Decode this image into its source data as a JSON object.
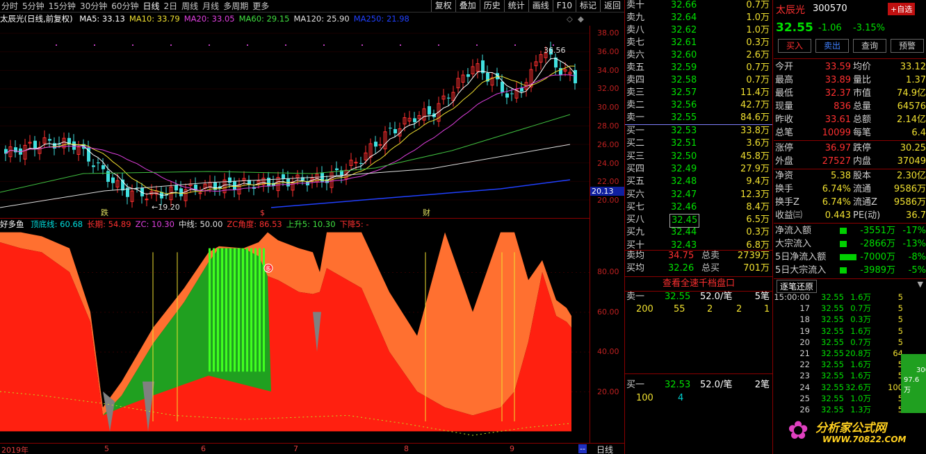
{
  "toolbar": {
    "periods": [
      "分时",
      "5分钟",
      "15分钟",
      "30分钟",
      "60分钟",
      "日线",
      "2日",
      "周线",
      "月线",
      "多周期",
      "更多"
    ],
    "active": "日线",
    "right_buttons": [
      "复权",
      "叠加",
      "历史",
      "统计",
      "画线",
      "F10",
      "标记",
      "返回"
    ]
  },
  "chart": {
    "title": "太辰光(日线,前复权)",
    "ma": [
      {
        "label": "MA5: 33.13",
        "color": "#ffffff"
      },
      {
        "label": "MA10: 33.79",
        "color": "#f0e030"
      },
      {
        "label": "MA20: 33.05",
        "color": "#e040e0"
      },
      {
        "label": "MA60: 29.15",
        "color": "#40e040"
      },
      {
        "label": "MA120: 25.90",
        "color": "#e0e0e0"
      },
      {
        "label": "MA250: 21.98",
        "color": "#2040ff"
      }
    ],
    "y_ticks": [
      "38.00",
      "36.00",
      "34.00",
      "32.00",
      "30.00",
      "28.00",
      "26.00",
      "24.00",
      "22.00",
      "20.00"
    ],
    "current_price_tag": "20.13",
    "high_label": "36.56",
    "low_label": "←19.20",
    "markers": [
      "跌",
      "$",
      "财"
    ]
  },
  "indicator": {
    "name": "好多鱼",
    "params": [
      {
        "label": "顶底线: 60.68",
        "color": "#00e0e0"
      },
      {
        "label": "长期: 54.89",
        "color": "#ff3030"
      },
      {
        "label": "ZC: 10.30",
        "color": "#e040e0"
      },
      {
        "label": "中线: 50.00",
        "color": "#e0e0e0"
      },
      {
        "label": "ZC角度: 86.53",
        "color": "#ff3030"
      },
      {
        "label": "上升5: 10.30",
        "color": "#40e040"
      },
      {
        "label": "下降5: -",
        "color": "#ff3030"
      }
    ],
    "y_ticks": [
      "80.00",
      "60.00",
      "40.00",
      "20.00"
    ],
    "marker": "多"
  },
  "date_axis": {
    "labels": [
      "2019年",
      "5",
      "6",
      "7",
      "8",
      "9"
    ],
    "corner": "--",
    "period_label": "日线"
  },
  "orderbook": {
    "asks": [
      {
        "label": "卖十",
        "price": "32.66",
        "vol": "0.7万"
      },
      {
        "label": "卖九",
        "price": "32.64",
        "vol": "1.0万"
      },
      {
        "label": "卖八",
        "price": "32.62",
        "vol": "1.0万"
      },
      {
        "label": "卖七",
        "price": "32.61",
        "vol": "0.3万"
      },
      {
        "label": "卖六",
        "price": "32.60",
        "vol": "2.6万"
      },
      {
        "label": "卖五",
        "price": "32.59",
        "vol": "0.7万"
      },
      {
        "label": "卖四",
        "price": "32.58",
        "vol": "0.7万"
      },
      {
        "label": "卖三",
        "price": "32.57",
        "vol": "11.4万"
      },
      {
        "label": "卖二",
        "price": "32.56",
        "vol": "42.7万"
      },
      {
        "label": "卖一",
        "price": "32.55",
        "vol": "84.6万"
      }
    ],
    "bids": [
      {
        "label": "买一",
        "price": "32.53",
        "vol": "33.8万"
      },
      {
        "label": "买二",
        "price": "32.51",
        "vol": "3.6万"
      },
      {
        "label": "买三",
        "price": "32.50",
        "vol": "45.8万"
      },
      {
        "label": "买四",
        "price": "32.49",
        "vol": "27.9万"
      },
      {
        "label": "买五",
        "price": "32.48",
        "vol": "9.4万"
      },
      {
        "label": "买六",
        "price": "32.47",
        "vol": "12.3万"
      },
      {
        "label": "买七",
        "price": "32.46",
        "vol": "8.4万"
      },
      {
        "label": "买八",
        "price": "32.45",
        "vol": "6.5万"
      },
      {
        "label": "买九",
        "price": "32.44",
        "vol": "0.3万"
      },
      {
        "label": "买十",
        "price": "32.43",
        "vol": "6.8万"
      }
    ],
    "avg_sell": {
      "label": "卖均",
      "price": "34.75",
      "total_label": "总卖",
      "total": "2739万"
    },
    "avg_buy": {
      "label": "买均",
      "price": "32.26",
      "total_label": "总买",
      "total": "701万"
    },
    "depth_link": "查看全速千档盘口",
    "sell1_detail": {
      "label": "卖一",
      "price": "32.55",
      "per": "52.0/笔",
      "count": "5笔",
      "queue": [
        "200",
        "55",
        "2",
        "2",
        "1"
      ]
    },
    "buy1_detail": {
      "label": "买一",
      "price": "32.53",
      "per": "52.0/笔",
      "count": "2笔",
      "queue": [
        "100",
        "4"
      ]
    }
  },
  "quote": {
    "name": "太辰光",
    "code": "300570",
    "add_label": "+自选",
    "price": "32.55",
    "change": "-1.06",
    "pct": "-3.15%",
    "buttons": [
      "买入",
      "卖出",
      "查询",
      "预警"
    ],
    "rows": [
      [
        "今开",
        "33.59",
        "均价",
        "33.12"
      ],
      [
        "最高",
        "33.89",
        "量比",
        "1.37"
      ],
      [
        "最低",
        "32.37",
        "市值",
        "74.9亿"
      ],
      [
        "现量",
        "836",
        "总量",
        "64576"
      ],
      [
        "昨收",
        "33.61",
        "总额",
        "2.14亿"
      ],
      [
        "总笔",
        "10099",
        "每笔",
        "6.4"
      ]
    ],
    "rows2": [
      [
        "涨停",
        "36.97",
        "跌停",
        "30.25"
      ],
      [
        "外盘",
        "27527",
        "内盘",
        "37049"
      ]
    ],
    "rows3": [
      [
        "净资",
        "5.38",
        "股本",
        "2.30亿"
      ],
      [
        "换手",
        "6.74%",
        "流通",
        "9586万"
      ],
      [
        "换手Z",
        "6.74%",
        "流通Z",
        "9586万"
      ],
      [
        "收益㈢",
        "0.443",
        "PE(动)",
        "36.7"
      ]
    ],
    "flows": [
      [
        "净流入额",
        "-3551万",
        "-17%"
      ],
      [
        "大宗流入",
        "-2866万",
        "-13%"
      ],
      [
        "5日净流入额",
        "-7000万",
        "-8%"
      ],
      [
        "5日大宗流入",
        "-3989万",
        "-5%"
      ]
    ],
    "trades_title": "逐笔还原",
    "trades": [
      [
        "15:00:00",
        "32.55",
        "1.6万",
        "5"
      ],
      [
        "17",
        "32.55",
        "0.7万",
        "5"
      ],
      [
        "18",
        "32.55",
        "0.3万",
        "5"
      ],
      [
        "19",
        "32.55",
        "1.6万",
        "5"
      ],
      [
        "20",
        "32.55",
        "0.7万",
        "5"
      ],
      [
        "21",
        "32.55",
        "20.8万",
        "64"
      ],
      [
        "22",
        "32.55",
        "1.6万",
        "5"
      ],
      [
        "23",
        "32.55",
        "1.6万",
        "5"
      ],
      [
        "24",
        "32.55",
        "32.6万",
        "100"
      ],
      [
        "25",
        "32.55",
        "1.0万",
        "5"
      ],
      [
        "26",
        "32.55",
        "1.3万",
        "5"
      ]
    ],
    "side_bar_text": [
      "300",
      "97.6万"
    ],
    "watermark": "分析家公式网",
    "watermark_url": "WWW.70822.COM"
  }
}
